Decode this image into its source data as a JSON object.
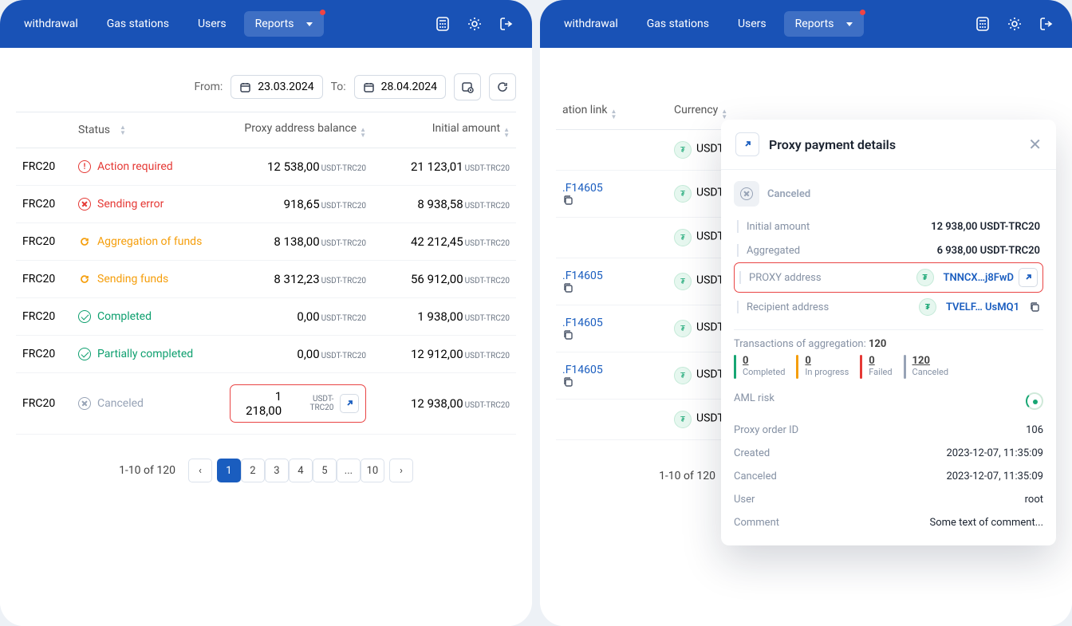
{
  "nav": {
    "withdrawal": "withdrawal",
    "gas": "Gas stations",
    "users": "Users",
    "reports": "Reports"
  },
  "filters": {
    "from": "From:",
    "to": "To:",
    "fromDate": "23.03.2024",
    "toDate": "28.04.2024"
  },
  "th": {
    "status": "Status",
    "bal": "Proxy address balance",
    "init": "Initial amount",
    "link": "ation link",
    "cur": "Currency"
  },
  "rows": [
    {
      "cur": "FRC20",
      "status": "Action required",
      "cls": "st-red",
      "bal": "12 538,00",
      "balc": "USDT-TRC20",
      "init": "21 123,01",
      "initc": "USDT-TRC20"
    },
    {
      "cur": "FRC20",
      "status": "Sending error",
      "cls": "st-err",
      "bal": "918,65",
      "balc": "USDT-TRC20",
      "init": "8 938,58",
      "initc": "USDT-TRC20",
      "link": ".F14605"
    },
    {
      "cur": "FRC20",
      "status": "Aggregation of funds",
      "cls": "st-org",
      "bal": "8 138,00",
      "balc": "USDT-TRC20",
      "init": "42 212,45",
      "initc": "USDT-TRC20"
    },
    {
      "cur": "FRC20",
      "status": "Sending funds",
      "cls": "st-org",
      "bal": "8 312,23",
      "balc": "USDT-TRC20",
      "init": "56 912,00",
      "initc": "USDT-TRC20",
      "link": ".F14605"
    },
    {
      "cur": "FRC20",
      "status": "Completed",
      "cls": "st-grn",
      "bal": "0,00",
      "balc": "USDT-TRC20",
      "init": "1 938,00",
      "initc": "USDT-TRC20",
      "link": ".F14605"
    },
    {
      "cur": "FRC20",
      "status": "Partially completed",
      "cls": "st-grn",
      "bal": "0,00",
      "balc": "USDT-TRC20",
      "init": "12 912,00",
      "initc": "USDT-TRC20",
      "link": ".F14605"
    },
    {
      "cur": "FRC20",
      "status": "Canceled",
      "cls": "st-gry",
      "bal": "1 218,00",
      "balc": "USDT-TRC20",
      "init": "12 938,00",
      "initc": "USDT-TRC20",
      "hl": true
    }
  ],
  "curlabel": "USDT-T",
  "pager": {
    "info": "1-10 of 120",
    "pages": [
      "1",
      "2",
      "3",
      "4",
      "5",
      "...",
      "10"
    ]
  },
  "modal": {
    "title": "Proxy payment details",
    "status": "Canceled",
    "initialK": "Initial amount",
    "initialV": "12 938,00 USDT-TRC20",
    "aggK": "Aggregated",
    "aggV": "6 938,00 USDT-TRC20",
    "proxyK": "PROXY address",
    "proxyV": "TNNCX…j8FwD",
    "recipK": "Recipient address",
    "recipV": "TVELF… UsMQ1",
    "txLabel": "Transactions of aggregation: ",
    "txCount": "120",
    "seg": [
      {
        "n": "0",
        "l": "Completed",
        "c": "#17a673"
      },
      {
        "n": "0",
        "l": "In progress",
        "c": "#f59e0b"
      },
      {
        "n": "0",
        "l": "Failed",
        "c": "#e53935"
      },
      {
        "n": "120",
        "l": "Canceled",
        "c": "#97a3b6"
      }
    ],
    "kv": [
      {
        "k": "AML risk",
        "aml": true
      },
      {
        "k": "Proxy order ID",
        "v": "106"
      },
      {
        "k": "Created",
        "v": "2023-12-07, 11:35:09"
      },
      {
        "k": "Canceled",
        "v": "2023-12-07, 11:35:09"
      },
      {
        "k": "User",
        "v": "root"
      },
      {
        "k": "Comment",
        "v": "Some text of comment..."
      }
    ]
  }
}
